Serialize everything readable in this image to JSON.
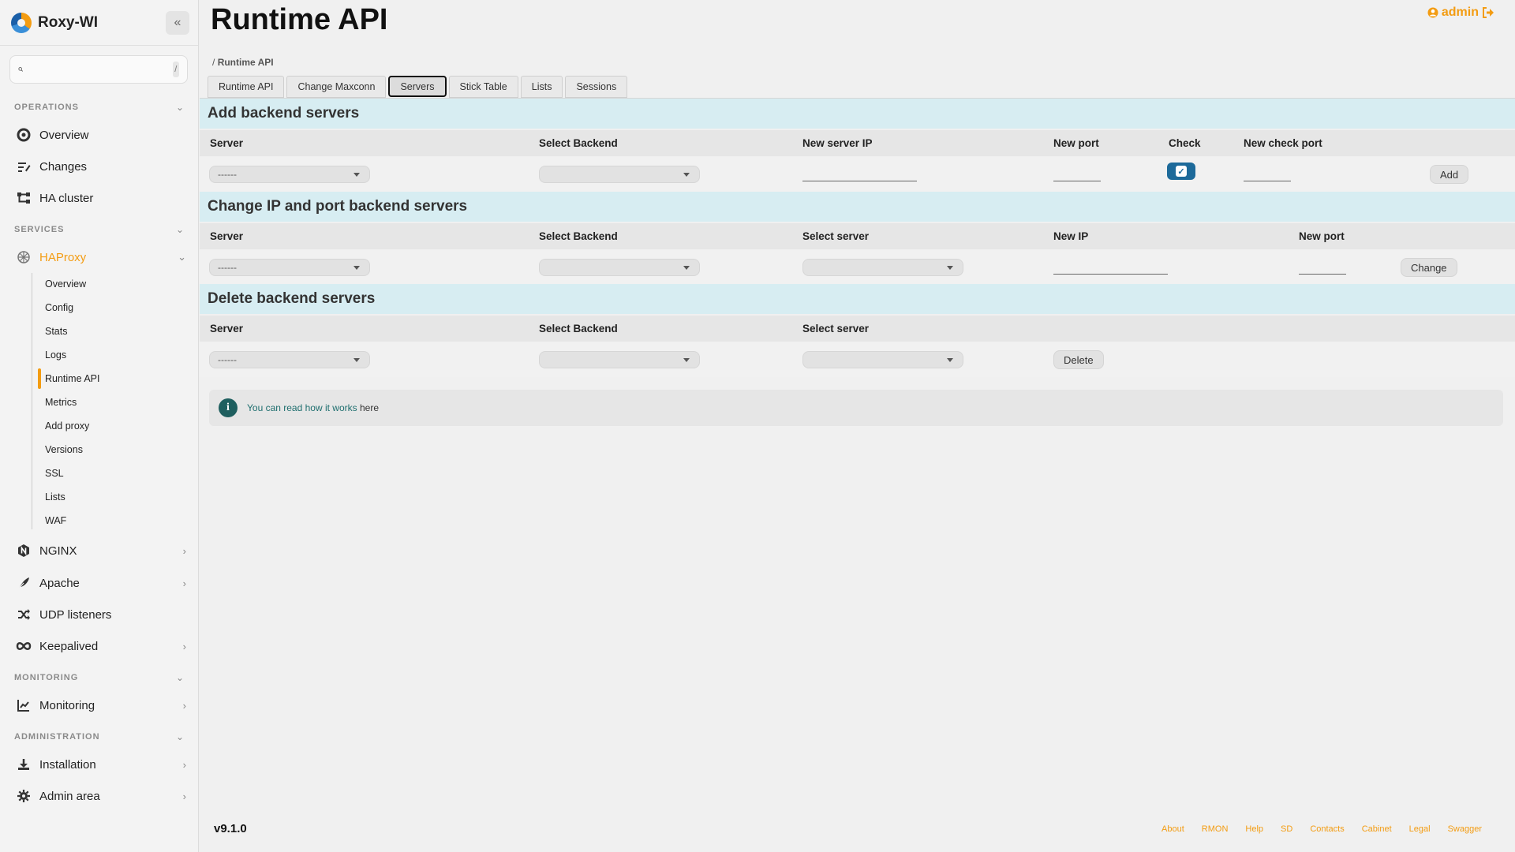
{
  "app": {
    "name": "Roxy-WI"
  },
  "sidebar": {
    "search_placeholder": "",
    "search_shortcut": "/",
    "sections": {
      "operations": "OPERATIONS",
      "services": "SERVICES",
      "monitoring": "MONITORING",
      "administration": "ADMINISTRATION"
    },
    "items": {
      "overview": "Overview",
      "changes": "Changes",
      "ha_cluster": "HA cluster",
      "haproxy": "HAProxy",
      "nginx": "NGINX",
      "apache": "Apache",
      "udp": "UDP listeners",
      "keepalived": "Keepalived",
      "monitoring": "Monitoring",
      "installation": "Installation",
      "admin_area": "Admin area"
    },
    "haproxy_sub": [
      "Overview",
      "Config",
      "Stats",
      "Logs",
      "Runtime API",
      "Metrics",
      "Add proxy",
      "Versions",
      "SSL",
      "Lists",
      "WAF"
    ],
    "active_sub": "Runtime API"
  },
  "header": {
    "title": "Runtime API",
    "user": "admin",
    "breadcrumb_sep": "/",
    "breadcrumb": "Runtime API"
  },
  "tabs": [
    "Runtime API",
    "Change Maxconn",
    "Servers",
    "Stick Table",
    "Lists",
    "Sessions"
  ],
  "active_tab": "Servers",
  "add_section": {
    "title": "Add backend servers",
    "headers": [
      "Server",
      "Select Backend",
      "New server IP",
      "New port",
      "Check",
      "New check port"
    ],
    "server_value": "------",
    "check_checked": true,
    "button": "Add"
  },
  "change_section": {
    "title": "Change IP and port backend servers",
    "headers": [
      "Server",
      "Select Backend",
      "Select server",
      "New IP",
      "New port"
    ],
    "server_value": "------",
    "button": "Change"
  },
  "delete_section": {
    "title": "Delete backend servers",
    "headers": [
      "Server",
      "Select Backend",
      "Select server"
    ],
    "server_value": "------",
    "button": "Delete"
  },
  "info": {
    "prefix": "You can read ",
    "link": "how it works",
    "suffix": " here"
  },
  "footer": {
    "version": "v9.1.0",
    "links": [
      "About",
      "RMON",
      "Help",
      "SD",
      "Contacts",
      "Cabinet",
      "Legal",
      "Swagger"
    ]
  },
  "colors": {
    "accent": "#f39c12",
    "section_bg": "#d7edf2",
    "checkbox": "#1d6a9a",
    "info_icon": "#1f5f5f"
  }
}
